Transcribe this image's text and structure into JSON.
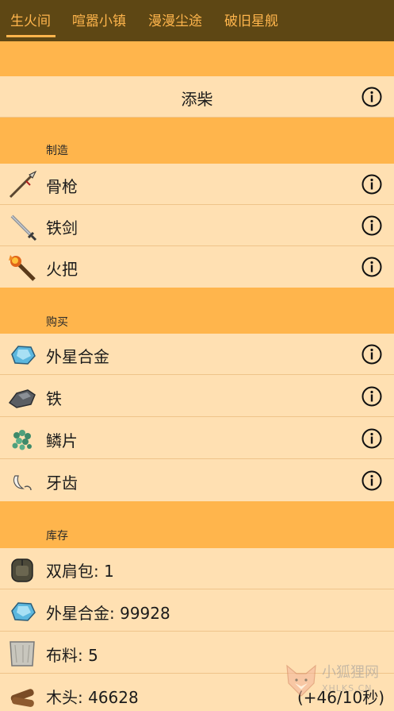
{
  "tabs": [
    {
      "label": "生火间",
      "active": true
    },
    {
      "label": "喧嚣小镇"
    },
    {
      "label": "漫漫尘途"
    },
    {
      "label": "破旧星舰"
    }
  ],
  "action": {
    "label": "添柴"
  },
  "craft": {
    "title": "制造",
    "items": [
      {
        "label": "骨枪",
        "icon": "bone-spear-icon"
      },
      {
        "label": "铁剑",
        "icon": "iron-sword-icon"
      },
      {
        "label": "火把",
        "icon": "torch-icon"
      }
    ]
  },
  "buy": {
    "title": "购买",
    "items": [
      {
        "label": "外星合金",
        "icon": "alien-alloy-icon"
      },
      {
        "label": "铁",
        "icon": "iron-ore-icon"
      },
      {
        "label": "鳞片",
        "icon": "scales-icon"
      },
      {
        "label": "牙齿",
        "icon": "teeth-icon"
      }
    ]
  },
  "stores": {
    "title": "库存",
    "items": [
      {
        "label": "双肩包: 1",
        "icon": "backpack-icon"
      },
      {
        "label": "外星合金: 99928",
        "icon": "alien-alloy-icon"
      },
      {
        "label": "布料: 5",
        "icon": "cloth-icon"
      },
      {
        "label": "木头: 46628",
        "icon": "wood-icon",
        "rate": "(+46/10秒)"
      }
    ]
  },
  "watermark": {
    "text": "小狐狸网",
    "subtext": "XHLKS.CN"
  },
  "colors": {
    "tabbar": "#5e4714",
    "accent": "#ffb54c",
    "row": "#ffe0b2"
  }
}
